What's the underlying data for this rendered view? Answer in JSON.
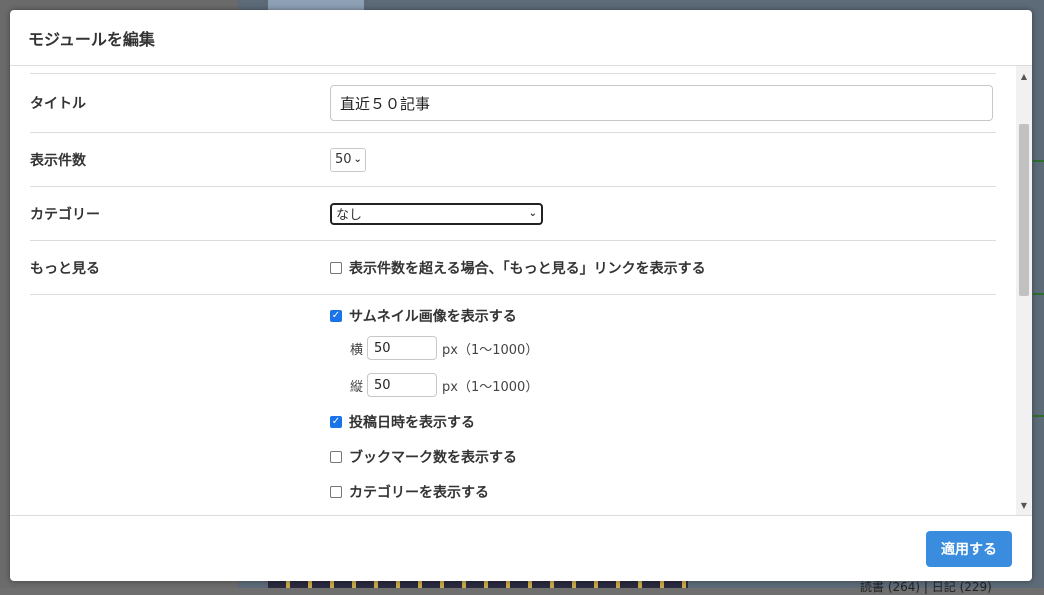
{
  "modal": {
    "title": "モジュールを編集",
    "apply_label": "適用する"
  },
  "form": {
    "title_label": "タイトル",
    "title_value": "直近５０記事",
    "count_label": "表示件数",
    "count_value": "50",
    "category_label": "カテゴリー",
    "category_value": "なし",
    "more_label": "もっと見る",
    "more_option": "表示件数を超える場合、「もっと見る」リンクを表示する",
    "more_checked": false,
    "thumbnail": {
      "label": "サムネイル画像を表示する",
      "checked": true,
      "width_label": "横",
      "width_value": "50",
      "height_label": "縦",
      "height_value": "50",
      "unit_range": "px（1〜1000）"
    },
    "post_date": {
      "label": "投稿日時を表示する",
      "checked": true
    },
    "bookmark_count": {
      "label": "ブックマーク数を表示する",
      "checked": false
    },
    "category_show": {
      "label": "カテゴリーを表示する",
      "checked": false
    }
  },
  "background": {
    "footer_text": "読書 (264) | 日記 (229)"
  }
}
